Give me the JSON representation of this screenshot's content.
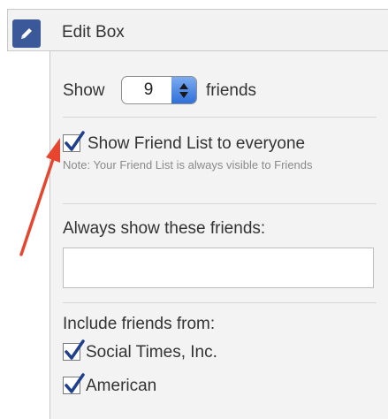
{
  "header": {
    "title": "Edit Box",
    "edit_icon": "pencil-icon"
  },
  "count_row": {
    "show_label": "Show",
    "selected_value": "9",
    "suffix_label": "friends"
  },
  "visibility": {
    "checkbox_label": "Show Friend List to everyone",
    "checked": true,
    "note": "Note: Your Friend List is always visible to Friends"
  },
  "always_show": {
    "label": "Always show these friends:",
    "value": "",
    "placeholder": ""
  },
  "include": {
    "label": "Include friends from:",
    "networks": [
      {
        "label": "Social Times, Inc.",
        "checked": true
      },
      {
        "label": "American",
        "checked": true
      }
    ]
  },
  "colors": {
    "accent": "#3b5998",
    "annotation_arrow": "#e8452f",
    "check_mark": "#1f3f8f"
  }
}
